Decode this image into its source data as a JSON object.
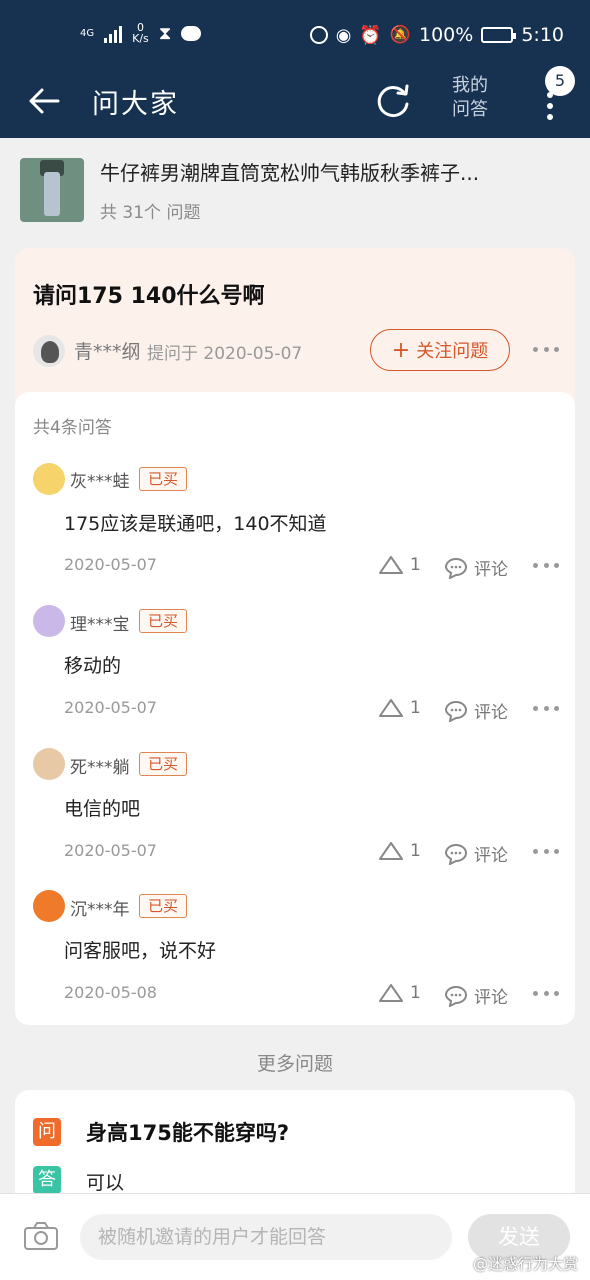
{
  "status_bar": {
    "network": "4G",
    "speed_value": "0",
    "speed_unit": "K/s",
    "battery": "100%",
    "time": "5:10"
  },
  "nav": {
    "title": "问大家",
    "my_qa": "我的问答",
    "badge": "5"
  },
  "product": {
    "title": "牛仔裤男潮牌直筒宽松帅气韩版秋季裤子...",
    "question_count": "共 31个 问题"
  },
  "question": {
    "title": "请问175 140什么号啊",
    "asker": "青***纲",
    "asked_on": "提问于 2020-05-07",
    "follow_label": "关注问题"
  },
  "answers": {
    "count_label": "共4条问答",
    "bought_label": "已买",
    "comment_label": "评论",
    "items": [
      {
        "user": "灰***蛙",
        "text": "175应该是联通吧，140不知道",
        "date": "2020-05-07",
        "likes": "1"
      },
      {
        "user": "理***宝",
        "text": "移动的",
        "date": "2020-05-07",
        "likes": "1"
      },
      {
        "user": "死***躺",
        "text": "电信的吧",
        "date": "2020-05-07",
        "likes": "1"
      },
      {
        "user": "沉***年",
        "text": "问客服吧，说不好",
        "date": "2020-05-08",
        "likes": "1"
      }
    ]
  },
  "more": {
    "heading": "更多问题",
    "q_tag": "问",
    "a_tag": "答",
    "question": "身高175能不能穿吗?",
    "answer": "可以"
  },
  "input_bar": {
    "placeholder": "被随机邀请的用户才能回答",
    "send_label": "发送"
  },
  "watermark": "@迷惑行为大赏",
  "colors": {
    "header": "#173150",
    "accent": "#d5582a",
    "question_card": "#fdf1ec",
    "q_tag": "#f06a2a",
    "a_tag": "#39c4a4"
  }
}
